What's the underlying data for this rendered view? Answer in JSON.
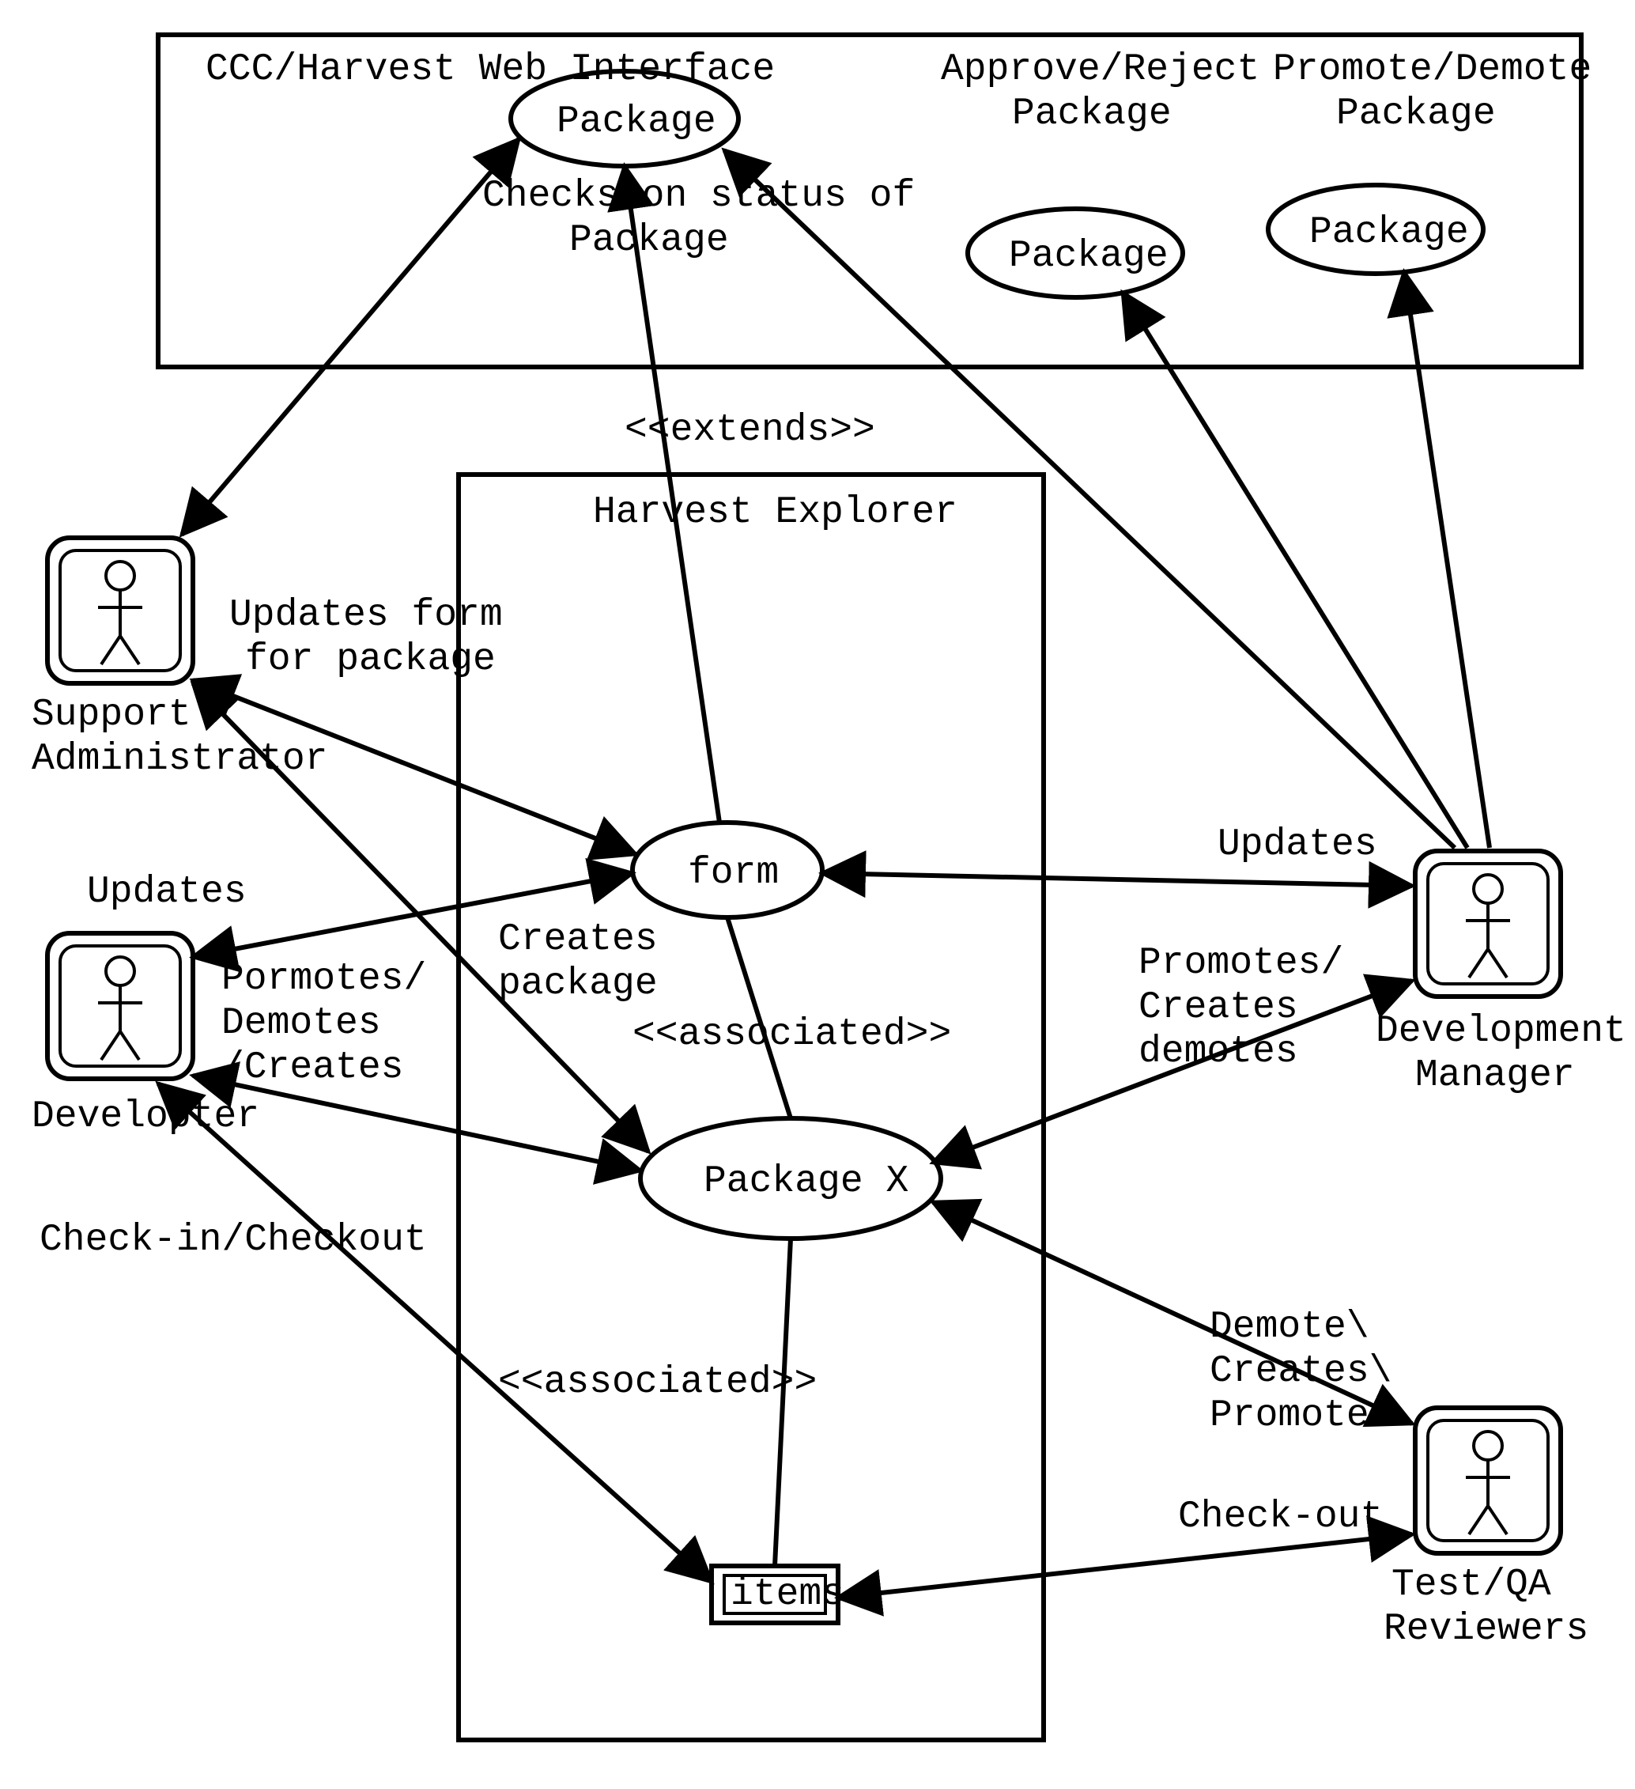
{
  "boxes": {
    "web_interface_title": "CCC/Harvest Web Interface",
    "harvest_explorer_title": "Harvest Explorer"
  },
  "usecases": {
    "package1_label": "Package",
    "package1_sub1": "Checks on status of",
    "package1_sub2": "Package",
    "approve_reject_head1": "Approve/Reject",
    "approve_reject_head2": "Package",
    "package2_label": "Package",
    "promote_demote_head1": "Promote/Demote",
    "promote_demote_head2": "Package",
    "package3_label": "Package",
    "form_label": "form",
    "packageX_label": "Package X",
    "items_label": "items"
  },
  "actors": {
    "support_admin_l1": "Support",
    "support_admin_l2": "Administrator",
    "developer": "Developter",
    "dev_manager_l1": "Development",
    "dev_manager_l2": "Manager",
    "tester_l1": "Test/QA",
    "tester_l2": "Reviewers"
  },
  "edges": {
    "extends": "<<extends>>",
    "associated": "<<associated>>",
    "updates_form_l1": "Updates form",
    "updates_form_l2": "for package",
    "updates": "Updates",
    "creates_package_l1": "Creates",
    "creates_package_l2": "package",
    "promotes_demotes_creates_l1": "Pormotes/",
    "promotes_demotes_creates_l2": "Demotes",
    "promotes_demotes_creates_l3": "/Creates",
    "checkin_checkout": "Check-in/Checkout",
    "updates2": "Updates",
    "promotes_creates_demotes_l1": "Promotes/",
    "promotes_creates_demotes_l2": "Creates",
    "promotes_creates_demotes_l3": "demotes",
    "demote_creates_promotes_l1": "Demote\\",
    "demote_creates_promotes_l2": "Creates\\",
    "demote_creates_promotes_l3": "Promotes",
    "checkout": "Check-out"
  }
}
